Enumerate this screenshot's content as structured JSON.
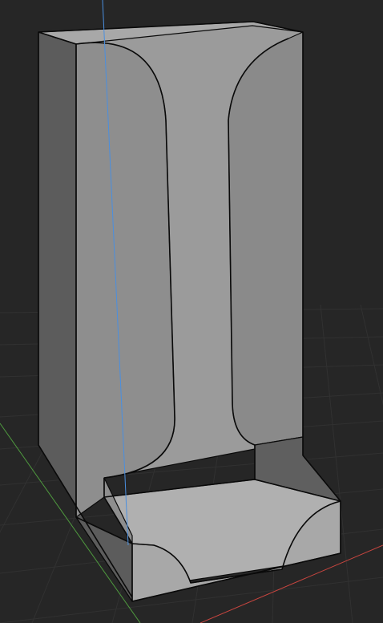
{
  "viewport": {
    "background_color": "#262626",
    "grid_color": "#3a3a3a",
    "x_axis_color": "#c8453f",
    "y_axis_color": "#4f9a3f",
    "z_axis_color": "#4a8fe0"
  },
  "model": {
    "face_colors": {
      "back_panel_inner": "#9b9b9b",
      "left_wall_outer": "#5c5c5c",
      "left_wall_inner": "#8e8e8e",
      "right_wall_inner": "#8a8a8a",
      "front_lip": "#a8a8a8",
      "tray_floor": "#b0b0b0",
      "tray_right_wall": "#5f5f5f",
      "edge_line": "#0a0a0a"
    }
  }
}
